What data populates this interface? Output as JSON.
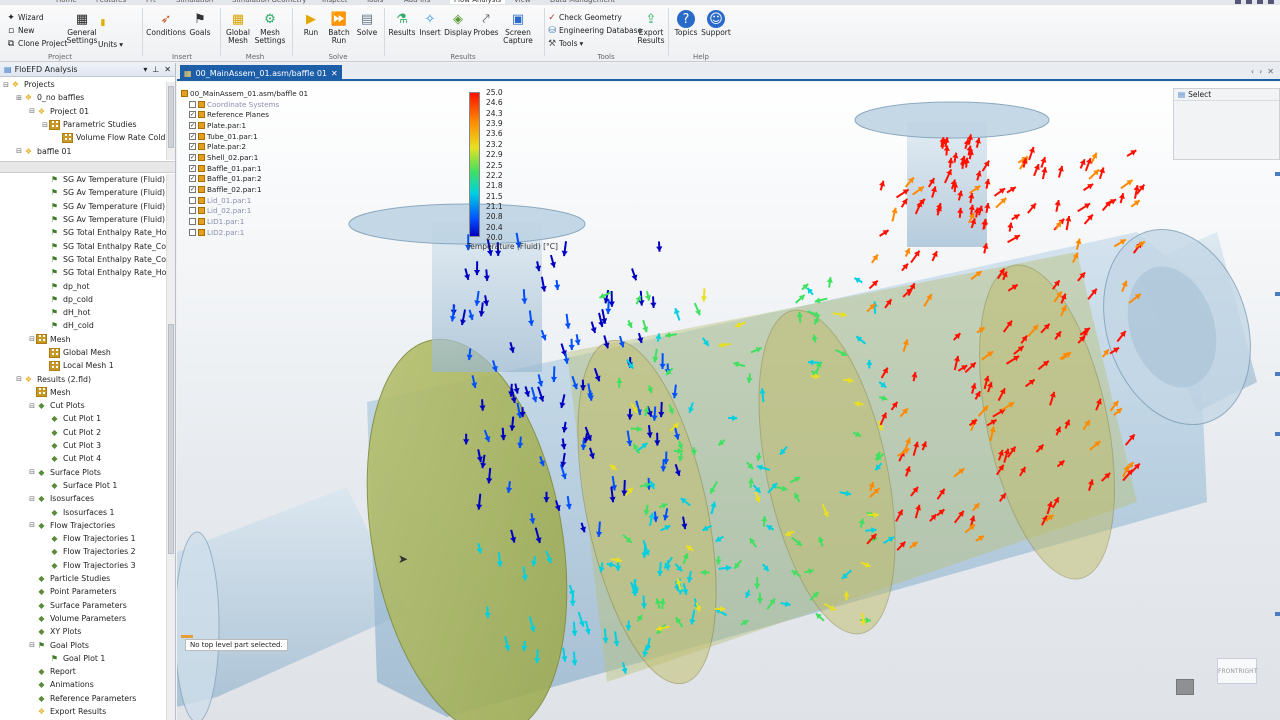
{
  "ribbon": {
    "tabs": [
      "Home",
      "Features",
      "Prt",
      "Simulation",
      "Simulation Geometry",
      "Inspect",
      "Tools",
      "Add-Ins",
      "Flow Analysis",
      "View",
      "Data Management"
    ],
    "active_tab": "Flow Analysis",
    "project": {
      "wizard": "Wizard",
      "new": "New",
      "clone_project": "Clone Project",
      "general_settings": "General\nSettings",
      "units": "Units",
      "label": "Project"
    },
    "insert": {
      "conditions": "Conditions",
      "goals": "Goals",
      "label": "Insert"
    },
    "mesh": {
      "global_mesh": "Global\nMesh",
      "mesh_settings": "Mesh\nSettings",
      "label": "Mesh"
    },
    "solve": {
      "run": "Run",
      "batch_run": "Batch\nRun",
      "solve_btn": "Solve",
      "label": "Solve"
    },
    "results": {
      "results": "Results",
      "insert": "Insert",
      "display": "Display",
      "probes": "Probes",
      "screen_capture": "Screen\nCapture",
      "label": "Results"
    },
    "tools": {
      "check_geometry": "Check Geometry",
      "engineering_database": "Engineering Database",
      "tools": "Tools",
      "export_results": "Export\nResults",
      "label": "Tools"
    },
    "help": {
      "topics": "Topics",
      "support": "Support",
      "label": "Help"
    }
  },
  "left_panel": {
    "title": "FloEFD Analysis",
    "projects_tree": [
      {
        "label": "Projects",
        "indent": 0,
        "icon": "projects-icon",
        "exp": "⊟"
      },
      {
        "label": "0_no baffles",
        "indent": 1,
        "icon": "project-config-icon",
        "exp": "⊞"
      },
      {
        "label": "Project 01",
        "indent": 2,
        "icon": "project-gear-icon",
        "exp": "⊟"
      },
      {
        "label": "Parametric Studies",
        "indent": 3,
        "icon": "parametric-grid-icon",
        "exp": "⊟"
      },
      {
        "label": "Volume Flow Rate Cold",
        "indent": 4,
        "icon": "parametric-grid-icon",
        "exp": ""
      },
      {
        "label": "baffle 01",
        "indent": 1,
        "icon": "project-config-icon",
        "exp": "⊟"
      }
    ],
    "analysis_tree": [
      {
        "label": "SG Av Temperature (Fluid) (",
        "indent": 3,
        "icon": "goal-icon"
      },
      {
        "label": "SG Av Temperature (Fluid) (",
        "indent": 3,
        "icon": "goal-icon"
      },
      {
        "label": "SG Av Temperature (Fluid) (",
        "indent": 3,
        "icon": "goal-icon"
      },
      {
        "label": "SG Av Temperature (Fluid) (",
        "indent": 3,
        "icon": "goal-icon"
      },
      {
        "label": "SG Total Enthalpy Rate_Hot",
        "indent": 3,
        "icon": "goal-icon"
      },
      {
        "label": "SG Total Enthalpy Rate_Colc",
        "indent": 3,
        "icon": "goal-icon"
      },
      {
        "label": "SG Total Enthalpy Rate_Colc",
        "indent": 3,
        "icon": "goal-icon"
      },
      {
        "label": "SG Total Enthalpy Rate_Hot",
        "indent": 3,
        "icon": "goal-icon"
      },
      {
        "label": "dp_hot",
        "indent": 3,
        "icon": "goal-icon"
      },
      {
        "label": "dp_cold",
        "indent": 3,
        "icon": "goal-icon"
      },
      {
        "label": "dH_hot",
        "indent": 3,
        "icon": "goal-icon"
      },
      {
        "label": "dH_cold",
        "indent": 3,
        "icon": "goal-icon"
      },
      {
        "label": "Mesh",
        "indent": 2,
        "icon": "mesh-grid-icon",
        "exp": "⊟"
      },
      {
        "label": "Global Mesh",
        "indent": 3,
        "icon": "mesh-grid-icon"
      },
      {
        "label": "Local Mesh 1",
        "indent": 3,
        "icon": "mesh-grid-icon"
      },
      {
        "label": "Results (2.fld)",
        "indent": 1,
        "icon": "results-icon",
        "exp": "⊟"
      },
      {
        "label": "Mesh",
        "indent": 2,
        "icon": "mesh-grid-icon"
      },
      {
        "label": "Cut Plots",
        "indent": 2,
        "icon": "cut-plot-icon",
        "exp": "⊟"
      },
      {
        "label": "Cut Plot 1",
        "indent": 3,
        "icon": "cut-plot-icon"
      },
      {
        "label": "Cut Plot 2",
        "indent": 3,
        "icon": "cut-plot-icon"
      },
      {
        "label": "Cut Plot 3",
        "indent": 3,
        "icon": "cut-plot-icon"
      },
      {
        "label": "Cut Plot 4",
        "indent": 3,
        "icon": "cut-plot-icon"
      },
      {
        "label": "Surface Plots",
        "indent": 2,
        "icon": "surface-plot-icon",
        "exp": "⊟"
      },
      {
        "label": "Surface Plot 1",
        "indent": 3,
        "icon": "surface-plot-icon"
      },
      {
        "label": "Isosurfaces",
        "indent": 2,
        "icon": "isosurface-icon",
        "exp": "⊟"
      },
      {
        "label": "Isosurfaces 1",
        "indent": 3,
        "icon": "isosurface-icon"
      },
      {
        "label": "Flow Trajectories",
        "indent": 2,
        "icon": "flow-trajectories-icon",
        "exp": "⊟"
      },
      {
        "label": "Flow Trajectories 1",
        "indent": 3,
        "icon": "flow-trajectories-icon"
      },
      {
        "label": "Flow Trajectories 2",
        "indent": 3,
        "icon": "flow-trajectories-icon"
      },
      {
        "label": "Flow Trajectories 3",
        "indent": 3,
        "icon": "flow-trajectories-icon"
      },
      {
        "label": "Particle Studies",
        "indent": 2,
        "icon": "particle-studies-icon"
      },
      {
        "label": "Point Parameters",
        "indent": 2,
        "icon": "point-parameters-icon"
      },
      {
        "label": "Surface Parameters",
        "indent": 2,
        "icon": "surface-parameters-icon"
      },
      {
        "label": "Volume Parameters",
        "indent": 2,
        "icon": "volume-parameters-icon"
      },
      {
        "label": "XY Plots",
        "indent": 2,
        "icon": "xy-plots-icon"
      },
      {
        "label": "Goal Plots",
        "indent": 2,
        "icon": "goal-plots-icon",
        "exp": "⊟"
      },
      {
        "label": "Goal Plot 1",
        "indent": 3,
        "icon": "goal-plots-icon"
      },
      {
        "label": "Report",
        "indent": 2,
        "icon": "report-icon"
      },
      {
        "label": "Animations",
        "indent": 2,
        "icon": "animations-icon"
      },
      {
        "label": "Reference Parameters",
        "indent": 2,
        "icon": "reference-parameters-icon"
      },
      {
        "label": "Export Results",
        "indent": 2,
        "icon": "export-results-icon"
      }
    ]
  },
  "document": {
    "tab_label": "00_MainAssem_01.asm/baffle 01",
    "assembly": [
      {
        "label": "00_MainAssem_01.asm/baffle 01",
        "level": 0,
        "checked": "",
        "dim": false
      },
      {
        "label": "Coordinate Systems",
        "level": 1,
        "checked": "",
        "dim": true
      },
      {
        "label": "Reference Planes",
        "level": 1,
        "checked": "✓",
        "dim": false
      },
      {
        "label": "Plate.par:1",
        "level": 1,
        "checked": "✓",
        "dim": false
      },
      {
        "label": "Tube_01.par:1",
        "level": 1,
        "checked": "✓",
        "dim": false
      },
      {
        "label": "Plate.par:2",
        "level": 1,
        "checked": "✓",
        "dim": false
      },
      {
        "label": "Shell_02.par:1",
        "level": 1,
        "checked": "✓",
        "dim": false
      },
      {
        "label": "Baffle_01.par:1",
        "level": 1,
        "checked": "✓",
        "dim": false
      },
      {
        "label": "Baffle_01.par:2",
        "level": 1,
        "checked": "✓",
        "dim": false
      },
      {
        "label": "Baffle_02.par:1",
        "level": 1,
        "checked": "✓",
        "dim": false
      },
      {
        "label": "Lid_01.par:1",
        "level": 1,
        "checked": "",
        "dim": true
      },
      {
        "label": "Lid_02.par:1",
        "level": 1,
        "checked": "",
        "dim": true
      },
      {
        "label": "LID1.par:1",
        "level": 1,
        "checked": "",
        "dim": true
      },
      {
        "label": "LID2.par:1",
        "level": 1,
        "checked": "",
        "dim": true
      }
    ],
    "legend": {
      "ticks": [
        "25.0",
        "24.6",
        "24.3",
        "23.9",
        "23.6",
        "23.2",
        "22.9",
        "22.5",
        "22.2",
        "21.8",
        "21.5",
        "21.1",
        "20.8",
        "20.4",
        "20.0"
      ],
      "title": "Temperature (Fluid) [°C]",
      "colors": [
        "#ff1000",
        "#ff8a00",
        "#e8e020",
        "#40e060",
        "#00d0e0",
        "#0050ff",
        "#0000c0"
      ]
    },
    "status_message": "No top level part selected.",
    "select_label": "Select",
    "view_cube": {
      "face1": "FRONT",
      "face2": "RIGHT"
    }
  }
}
